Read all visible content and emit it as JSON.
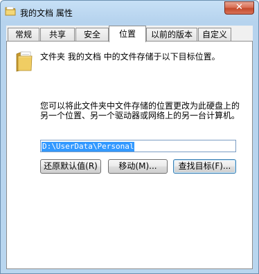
{
  "window": {
    "title": "我的文档 属性",
    "close_symbol": "✕"
  },
  "tabs": [
    {
      "label": "常规"
    },
    {
      "label": "共享"
    },
    {
      "label": "安全"
    },
    {
      "label": "位置",
      "active": true
    },
    {
      "label": "以前的版本"
    },
    {
      "label": "自定义"
    }
  ],
  "location": {
    "icon": "folder-icon",
    "description": "文件夹 我的文档 中的文件存储于以下目标位置。",
    "info": "您可以将此文件夹中文件存储的位置更改为此硬盘上的另一个位置、另一个驱动器或网络上的另一台计算机。",
    "path_value": "D:\\UserData\\Personal"
  },
  "buttons": {
    "restore_default": "还原默认值(R)",
    "move": "移动(M)...",
    "find_target": "查找目标(F)..."
  },
  "colors": {
    "title_bar": "#b9d6ef",
    "close_button": "#c44a2c",
    "selection": "#3399ff",
    "folder": "#e8c25a"
  }
}
